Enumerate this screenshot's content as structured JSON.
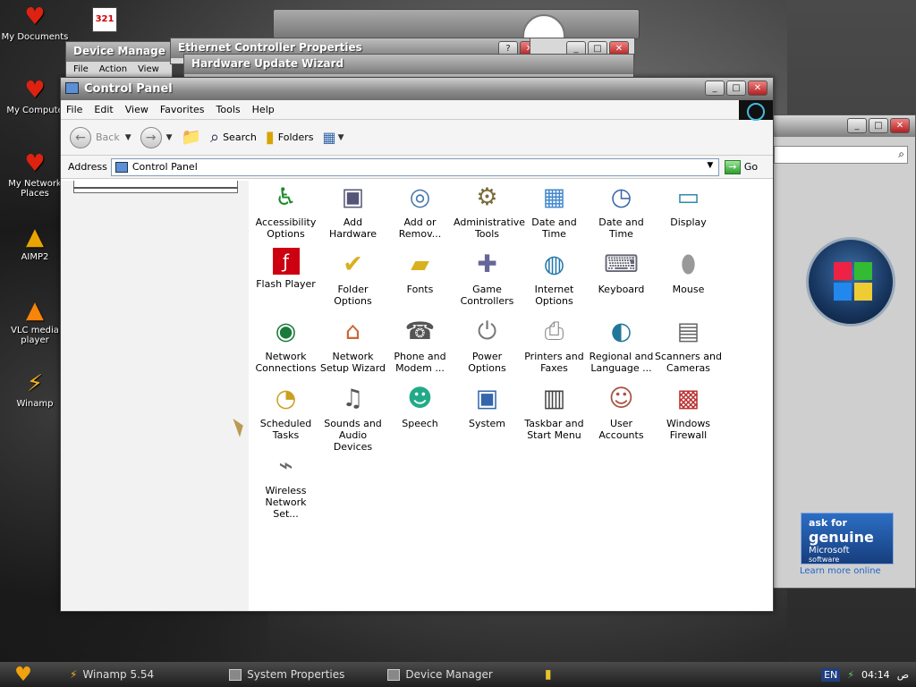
{
  "desktop": {
    "icons": [
      {
        "label": "My Documents",
        "icon": "heart-icon"
      },
      {
        "label": "My Compute",
        "icon": "heart-icon"
      },
      {
        "label": "My Network Places",
        "icon": "heart-icon"
      },
      {
        "label": "AIMP2",
        "icon": "aimp-icon"
      },
      {
        "label": "VLC media player",
        "icon": "vlc-cone-icon"
      },
      {
        "label": "Winamp",
        "icon": "winamp-icon"
      }
    ],
    "top_icon_label": "321"
  },
  "background_windows": {
    "device_manager": {
      "title": "Device Manage",
      "menu": [
        "File",
        "Action",
        "View"
      ]
    },
    "ethernet": {
      "title": "Ethernet Controller Properties"
    },
    "hardware_wizard": {
      "title": "Hardware Update Wizard"
    }
  },
  "window": {
    "title": "Control Panel",
    "menu": [
      "File",
      "Edit",
      "View",
      "Favorites",
      "Tools",
      "Help"
    ],
    "toolbar": {
      "back": "Back",
      "search": "Search",
      "folders": "Folders"
    },
    "address_label": "Address",
    "address_value": "Control Panel",
    "go_label": "Go"
  },
  "items": [
    {
      "label": "Accessibility Options",
      "icon": "accessibility-icon"
    },
    {
      "label": "Add Hardware",
      "icon": "add-hardware-icon"
    },
    {
      "label": "Add or Remov...",
      "icon": "add-remove-programs-icon"
    },
    {
      "label": "Administrative Tools",
      "icon": "admin-tools-icon"
    },
    {
      "label": "Date and Time",
      "icon": "calendar-icon"
    },
    {
      "label": "Date and Time",
      "icon": "clock-icon"
    },
    {
      "label": "Display",
      "icon": "display-icon"
    },
    {
      "label": "Flash Player",
      "icon": "flash-icon"
    },
    {
      "label": "Folder Options",
      "icon": "folder-options-icon"
    },
    {
      "label": "Fonts",
      "icon": "fonts-folder-icon"
    },
    {
      "label": "Game Controllers",
      "icon": "gamepad-icon"
    },
    {
      "label": "Internet Options",
      "icon": "globe-icon"
    },
    {
      "label": "Keyboard",
      "icon": "keyboard-icon"
    },
    {
      "label": "Mouse",
      "icon": "mouse-icon"
    },
    {
      "label": "Network Connections",
      "icon": "network-globe-icon"
    },
    {
      "label": "Network Setup Wizard",
      "icon": "house-network-icon"
    },
    {
      "label": "Phone and Modem ...",
      "icon": "phone-icon"
    },
    {
      "label": "Power Options",
      "icon": "power-plug-icon"
    },
    {
      "label": "Printers and Faxes",
      "icon": "printer-icon"
    },
    {
      "label": "Regional and Language ...",
      "icon": "world-globe-icon"
    },
    {
      "label": "Scanners and Cameras",
      "icon": "camera-icon"
    },
    {
      "label": "Scheduled Tasks",
      "icon": "scheduled-tasks-icon"
    },
    {
      "label": "Sounds and Audio Devices",
      "icon": "speaker-icon"
    },
    {
      "label": "Speech",
      "icon": "speech-icon"
    },
    {
      "label": "System",
      "icon": "computer-icon"
    },
    {
      "label": "Taskbar and Start Menu",
      "icon": "taskbar-icon"
    },
    {
      "label": "User Accounts",
      "icon": "users-icon"
    },
    {
      "label": "Windows Firewall",
      "icon": "firewall-icon"
    },
    {
      "label": "Wireless Network Set...",
      "icon": "wireless-icon"
    }
  ],
  "right_panel": {
    "genuine_line1": "ask for",
    "genuine_line2": "genuine",
    "genuine_line3": "Microsoft",
    "genuine_line4": "software",
    "learn_text": "Learn more online"
  },
  "taskbar": {
    "tasks": [
      "Winamp 5.54",
      "System Properties",
      "Device Manager"
    ],
    "lang": "EN",
    "time": "04:14",
    "ampm": "ص"
  }
}
